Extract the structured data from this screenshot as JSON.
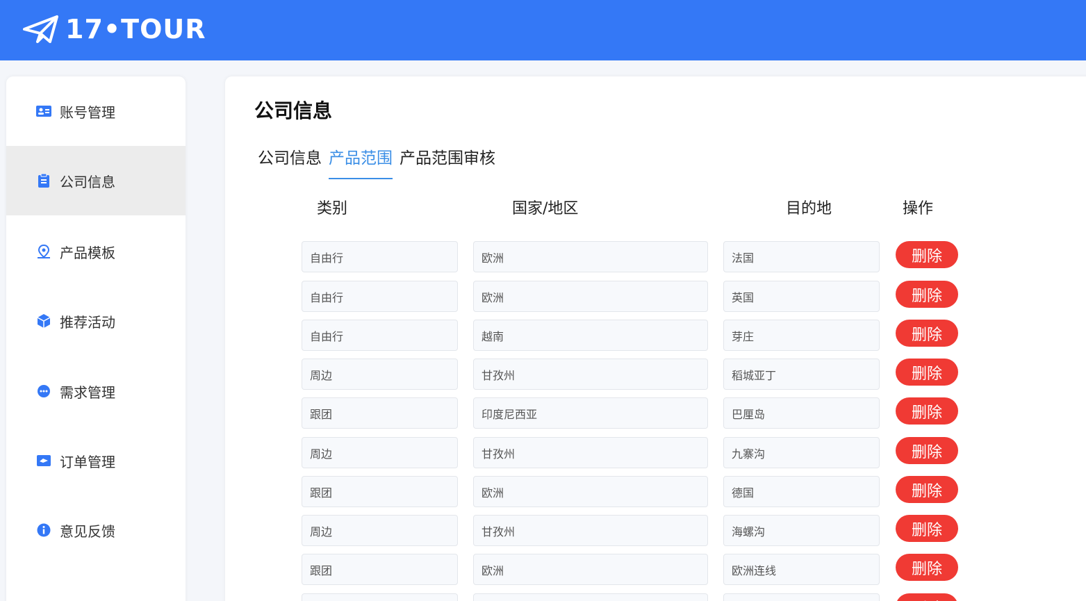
{
  "header": {
    "logo_text": "17•TOUR",
    "logo_icon": "paper-plane-icon",
    "background": "#3478f6"
  },
  "sidebar": {
    "items": [
      {
        "label": "账号管理",
        "icon": "id-card-icon",
        "active": false
      },
      {
        "label": "公司信息",
        "icon": "clipboard-icon",
        "active": true
      },
      {
        "label": "产品模板",
        "icon": "location-pin-icon",
        "active": false
      },
      {
        "label": "推荐活动",
        "icon": "cube-icon",
        "active": false
      },
      {
        "label": "需求管理",
        "icon": "chat-bubble-icon",
        "active": false
      },
      {
        "label": "订单管理",
        "icon": "ticket-icon",
        "active": false
      },
      {
        "label": "意见反馈",
        "icon": "info-icon",
        "active": false
      }
    ]
  },
  "main": {
    "title": "公司信息",
    "tabs": [
      {
        "label": "公司信息",
        "active": false
      },
      {
        "label": "产品范围",
        "active": true
      },
      {
        "label": "产品范围审核",
        "active": false
      }
    ],
    "columns": [
      "类别",
      "国家/地区",
      "目的地",
      "操作"
    ],
    "delete_label": "删除",
    "rows": [
      {
        "category": "自由行",
        "region": "欧洲",
        "destination": "法国"
      },
      {
        "category": "自由行",
        "region": "欧洲",
        "destination": "英国"
      },
      {
        "category": "自由行",
        "region": "越南",
        "destination": "芽庄"
      },
      {
        "category": "周边",
        "region": "甘孜州",
        "destination": "稻城亚丁"
      },
      {
        "category": "跟团",
        "region": "印度尼西亚",
        "destination": "巴厘岛"
      },
      {
        "category": "周边",
        "region": "甘孜州",
        "destination": "九寨沟"
      },
      {
        "category": "跟团",
        "region": "欧洲",
        "destination": "德国"
      },
      {
        "category": "周边",
        "region": "甘孜州",
        "destination": "海螺沟"
      },
      {
        "category": "跟团",
        "region": "欧洲",
        "destination": "欧洲连线"
      },
      {
        "category": "",
        "region": "",
        "destination": ""
      }
    ]
  },
  "colors": {
    "accent": "#3478f6",
    "tab_active": "#3a8ee6",
    "delete": "#f03a34",
    "active_item_bg": "#ececec"
  }
}
